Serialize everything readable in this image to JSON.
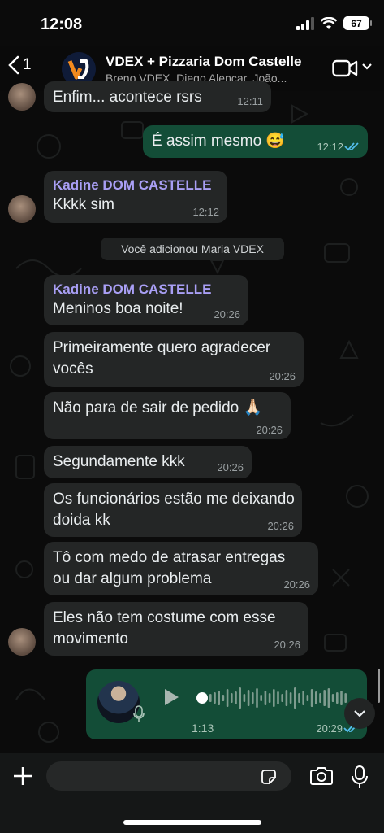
{
  "status_bar": {
    "time": "12:08",
    "battery": "67"
  },
  "header": {
    "back_count": "1",
    "group_name": "VDEX + Pizzaria Dom Castelle",
    "members": "Breno VDEX, Diego Alencar, João..."
  },
  "messages": [
    {
      "text": "Enfim... acontece rsrs",
      "time": "12:11"
    },
    {
      "text": "É assim mesmo 😅",
      "time": "12:12"
    },
    {
      "sender": "Kadine DOM CASTELLE",
      "text": "Kkkk sim",
      "time": "12:12"
    },
    {
      "system": "Você adicionou Maria VDEX"
    },
    {
      "sender": "Kadine DOM CASTELLE",
      "text": "Meninos boa noite!",
      "time": "20:26"
    },
    {
      "text": "Primeiramente quero agradecer vocês",
      "time": "20:26"
    },
    {
      "text": "Não para de sair de pedido 🙏🏻",
      "time": "20:26"
    },
    {
      "text": "Segundamente kkk",
      "time": "20:26"
    },
    {
      "text": "Os funcionários estão me deixando doida kk",
      "time": "20:26"
    },
    {
      "text": "Tô com medo de atrasar entregas ou dar algum problema",
      "time": "20:26"
    },
    {
      "text": "Eles não tem costume com esse movimento",
      "time": "20:26"
    }
  ],
  "voice_message": {
    "duration": "1:13",
    "time": "20:29",
    "progress": 0
  },
  "composer": {
    "placeholder": ""
  },
  "colors": {
    "incoming_bubble": "#242626",
    "outgoing_bubble": "#134d37",
    "sender_name": "#a99ff5",
    "read_ticks": "#53bdeb"
  },
  "icons": [
    "back-chevron-icon",
    "video-call-icon",
    "chevron-down-icon",
    "play-icon",
    "mic-icon",
    "plus-icon",
    "sticker-icon",
    "camera-icon",
    "read-ticks-icon"
  ]
}
